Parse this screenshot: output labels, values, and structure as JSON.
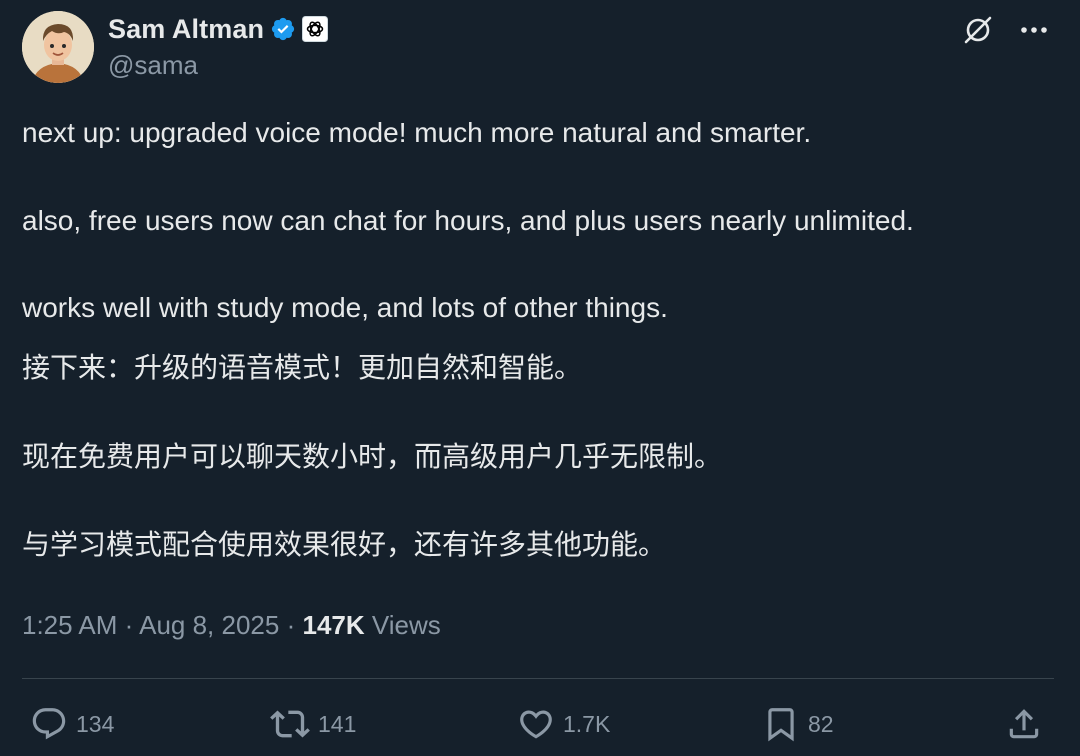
{
  "author": {
    "display_name": "Sam Altman",
    "handle": "@sama",
    "verified_icon": "verified-badge-icon",
    "affiliate_icon": "openai-logo-icon"
  },
  "top_actions": {
    "grok_icon": "grok-icon",
    "more_icon": "more-horizontal-icon"
  },
  "tweet": {
    "paragraphs": [
      "next up: upgraded voice mode! much more natural and smarter.",
      "also, free users now can chat for hours, and plus users nearly unlimited.",
      "works well with study mode, and lots of other things.",
      "接下来：升级的语音模式！更加自然和智能。",
      "现在免费用户可以聊天数小时，而高级用户几乎无限制。",
      "与学习模式配合使用效果很好，还有许多其他功能。"
    ],
    "time": "1:25 AM",
    "separator": "·",
    "date": "Aug 8, 2025",
    "views_count": "147K",
    "views_label": "Views"
  },
  "actions": {
    "replies": "134",
    "reposts": "141",
    "likes": "1.7K",
    "bookmarks": "82"
  },
  "colors": {
    "background": "#15202b",
    "text_primary": "#e7e9ea",
    "text_secondary": "#8b98a5",
    "verified_blue": "#1d9bf0",
    "divider": "#38444d"
  }
}
